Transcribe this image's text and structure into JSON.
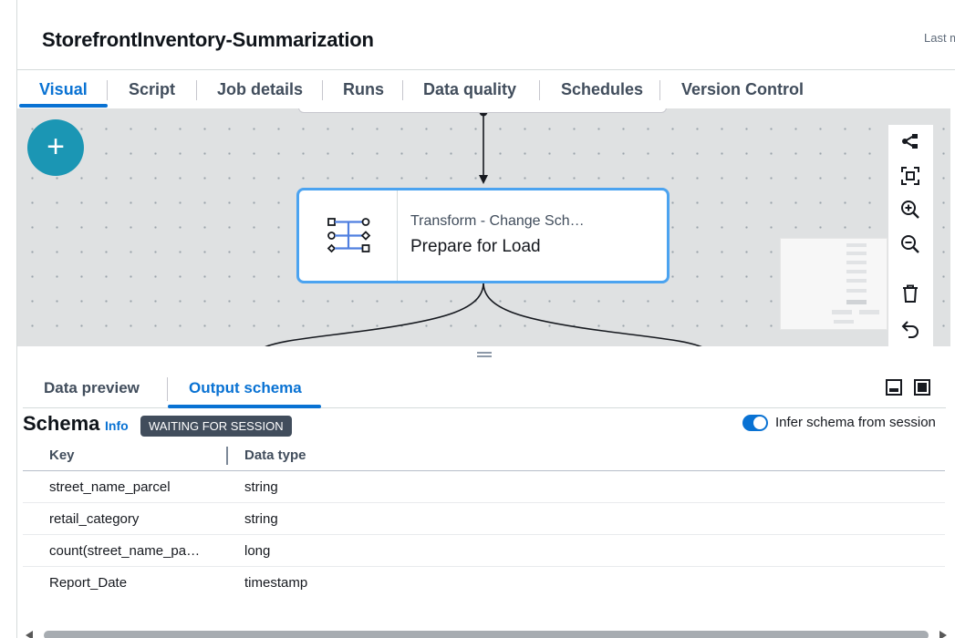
{
  "header": {
    "job_title": "StorefrontInventory-Summarization",
    "last_modified_fragment": "Last m"
  },
  "tabs": [
    {
      "label": "Visual",
      "active": true
    },
    {
      "label": "Script",
      "active": false
    },
    {
      "label": "Job details",
      "active": false
    },
    {
      "label": "Runs",
      "active": false
    },
    {
      "label": "Data quality",
      "active": false
    },
    {
      "label": "Schedules",
      "active": false
    },
    {
      "label": "Version Control",
      "active": false
    }
  ],
  "canvas": {
    "add_button_label": "+",
    "node": {
      "type_label": "Transform - Change Sch…",
      "name": "Prepare for Load",
      "icon": "change-schema-icon",
      "selected": true
    },
    "toolbar": [
      "layout-graph-icon",
      "fit-to-screen-icon",
      "zoom-in-icon",
      "zoom-out-icon",
      "delete-icon",
      "undo-icon"
    ]
  },
  "panel": {
    "tabs": [
      {
        "label": "Data preview",
        "active": false
      },
      {
        "label": "Output schema",
        "active": true
      }
    ],
    "icons": [
      "minimize-panel-icon",
      "maximize-panel-icon"
    ],
    "schema": {
      "heading": "Schema",
      "info_link": "Info",
      "status_badge": "WAITING FOR SESSION",
      "infer_toggle": {
        "label": "Infer schema from session",
        "on": true
      },
      "columns": [
        "Key",
        "Data type"
      ],
      "rows": [
        {
          "key": "street_name_parcel",
          "data_type": "string"
        },
        {
          "key": "retail_category",
          "data_type": "string"
        },
        {
          "key": "count(street_name_pa…",
          "data_type": "long"
        },
        {
          "key": "Report_Date",
          "data_type": "timestamp"
        }
      ]
    }
  },
  "colors": {
    "accent": "#0972d3",
    "add_button": "#1b96b4",
    "node_border": "#4ba3f0",
    "badge_bg": "#414d5c"
  }
}
